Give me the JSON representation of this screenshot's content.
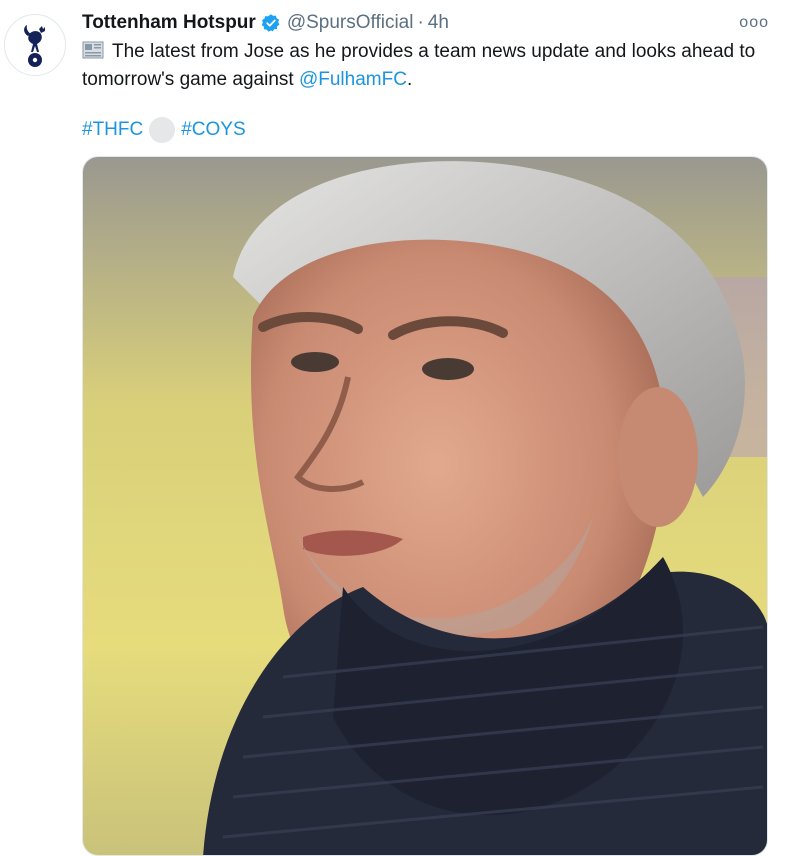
{
  "tweet": {
    "display_name": "Tottenham Hotspur",
    "handle": "@SpursOfficial",
    "separator": "·",
    "time": "4h",
    "more_label": "ooo",
    "text_before": "The latest from Jose as he provides a team news update and looks ahead to tomorrow's game against ",
    "mention": "@FulhamFC",
    "text_after": ".",
    "hashtag_1": "#THFC",
    "hashtag_2": "#COYS"
  },
  "icons": {
    "avatar": "spurs-cockerel-logo",
    "verified": "verified-badge-icon",
    "emoji_1": "newspaper-emoji",
    "emoji_2": "white-circle-emoji"
  },
  "colors": {
    "link": "#1b95e0",
    "verified": "#1da1f2",
    "text": "#14171a",
    "secondary": "#5b7083"
  }
}
